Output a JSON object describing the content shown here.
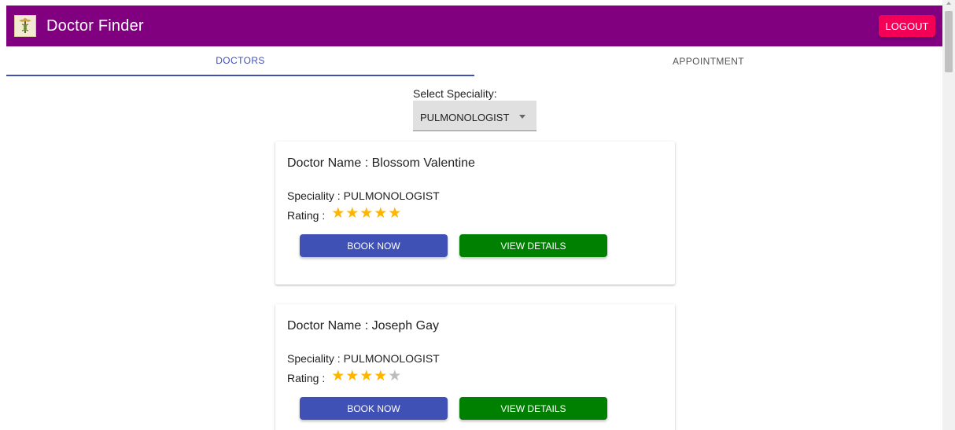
{
  "appbar": {
    "title": "Doctor Finder",
    "logo_icon": "caduceus-icon",
    "logout_label": "LOGOUT"
  },
  "tabs": [
    {
      "label": "DOCTORS",
      "active": true
    },
    {
      "label": "APPOINTMENT",
      "active": false
    }
  ],
  "speciality_select": {
    "label": "Select Speciality:",
    "value": "PULMONOLOGIST"
  },
  "doctors": [
    {
      "name": "Doctor Name : Blossom Valentine",
      "speciality": "Speciality : PULMONOLOGIST",
      "rating_label": "Rating :",
      "rating": 5,
      "book_label": "BOOK NOW",
      "view_label": "VIEW DETAILS"
    },
    {
      "name": "Doctor Name : Joseph Gay",
      "speciality": "Speciality : PULMONOLOGIST",
      "rating_label": "Rating :",
      "rating": 4,
      "book_label": "BOOK NOW",
      "view_label": "VIEW DETAILS"
    }
  ],
  "colors": {
    "appbar": "#800080",
    "logout": "#f50057",
    "primary": "#3f51b5",
    "view_button": "#008000",
    "star": "#ffb400",
    "star_off": "#bdbdbd"
  }
}
